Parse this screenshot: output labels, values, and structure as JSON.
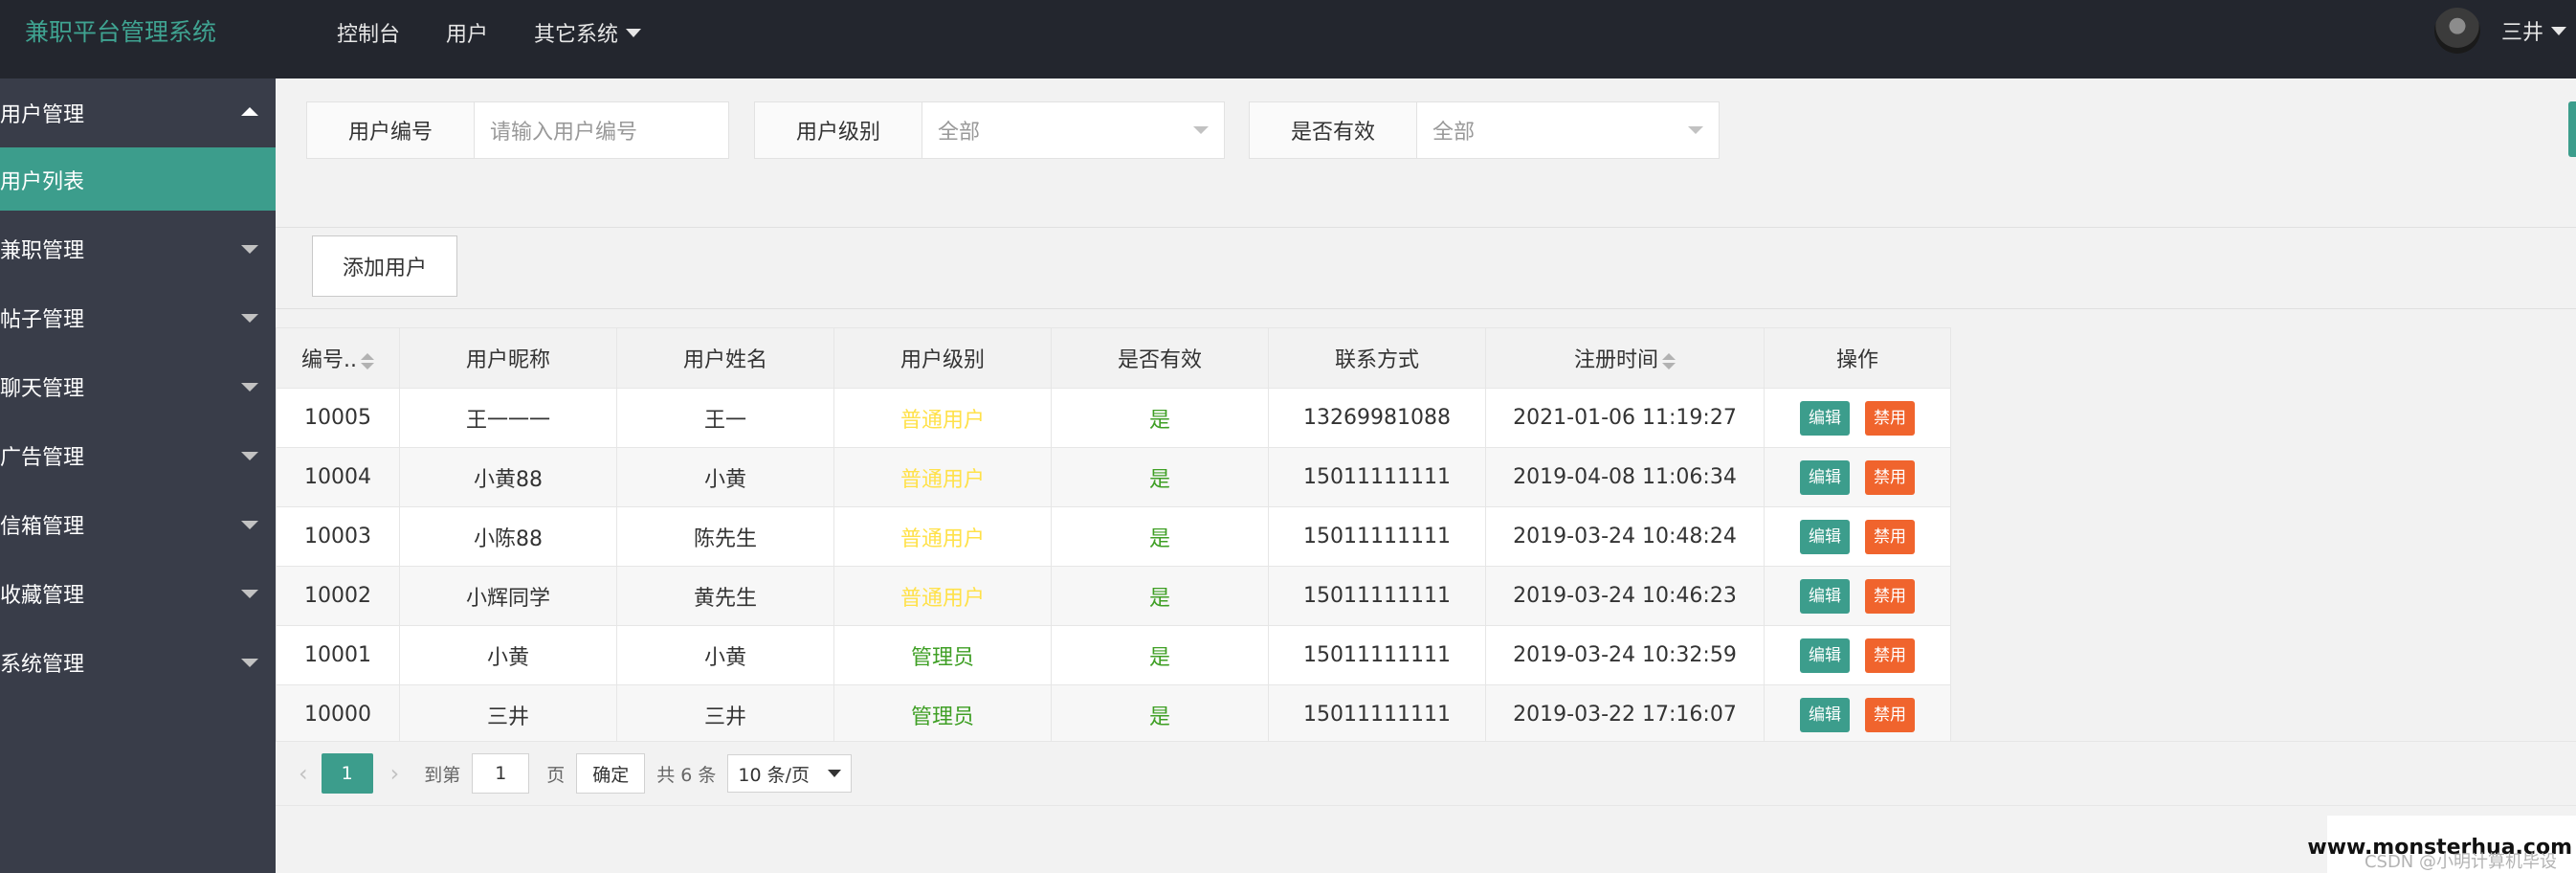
{
  "brand": "兼职平台管理系统",
  "top_nav": [
    "控制台",
    "用户",
    "其它系统"
  ],
  "user": {
    "name": "三井"
  },
  "sidebar": {
    "groups": [
      {
        "label": "用户管理",
        "expanded": true,
        "children": [
          "用户列表"
        ]
      },
      {
        "label": "兼职管理"
      },
      {
        "label": "帖子管理"
      },
      {
        "label": "聊天管理"
      },
      {
        "label": "广告管理"
      },
      {
        "label": "信箱管理"
      },
      {
        "label": "收藏管理"
      },
      {
        "label": "系统管理"
      }
    ]
  },
  "filters": {
    "user_id": {
      "label": "用户编号",
      "placeholder": "请输入用户编号"
    },
    "level": {
      "label": "用户级别",
      "value": "全部"
    },
    "valid": {
      "label": "是否有效",
      "value": "全部"
    }
  },
  "toolbar": {
    "add_label": "添加用户"
  },
  "table": {
    "headers": [
      "编号..",
      "用户昵称",
      "用户姓名",
      "用户级别",
      "是否有效",
      "联系方式",
      "注册时间",
      "操作"
    ],
    "rows": [
      {
        "id": "10005",
        "nickname": "王一一一",
        "name": "王一",
        "level": "普通用户",
        "valid": "是",
        "phone": "13269981088",
        "time": "2021-01-06 11:19:27"
      },
      {
        "id": "10004",
        "nickname": "小黄88",
        "name": "小黄",
        "level": "普通用户",
        "valid": "是",
        "phone": "15011111111",
        "time": "2019-04-08 11:06:34"
      },
      {
        "id": "10003",
        "nickname": "小陈88",
        "name": "陈先生",
        "level": "普通用户",
        "valid": "是",
        "phone": "15011111111",
        "time": "2019-03-24 10:48:24"
      },
      {
        "id": "10002",
        "nickname": "小辉同学",
        "name": "黄先生",
        "level": "普通用户",
        "valid": "是",
        "phone": "15011111111",
        "time": "2019-03-24 10:46:23"
      },
      {
        "id": "10001",
        "nickname": "小黄",
        "name": "小黄",
        "level": "管理员",
        "valid": "是",
        "phone": "15011111111",
        "time": "2019-03-24 10:32:59"
      },
      {
        "id": "10000",
        "nickname": "三井",
        "name": "三井",
        "level": "管理员",
        "valid": "是",
        "phone": "15011111111",
        "time": "2019-03-22 17:16:07"
      }
    ],
    "actions": {
      "edit": "编辑",
      "ban": "禁用"
    }
  },
  "pagination": {
    "current": "1",
    "goto_label": "到第",
    "goto_value": "1",
    "page_unit": "页",
    "confirm": "确定",
    "total": "共 6 条",
    "page_size": "10 条/页",
    "prev": "‹",
    "next": "›"
  },
  "watermark": {
    "site": "www.monsterhua.com",
    "csdn": "CSDN @小明计算机毕设"
  },
  "colors": {
    "accent": "#3c9d8c",
    "sidebar": "#393d49",
    "topbar": "#23262e",
    "danger": "#f0642d",
    "normal_level": "#ffe14a",
    "admin_level": "#3f9f25"
  }
}
